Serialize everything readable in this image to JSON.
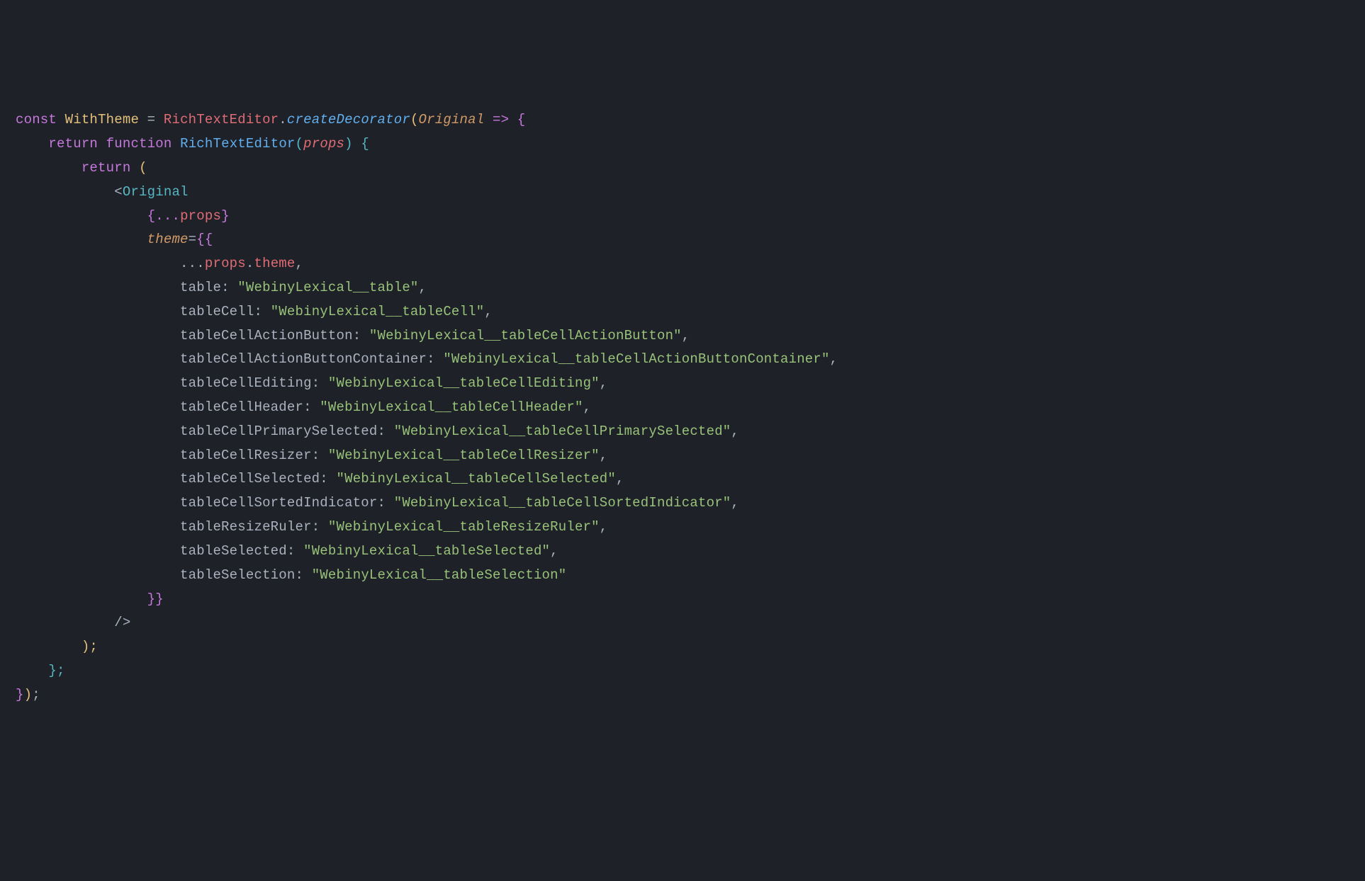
{
  "tokens": {
    "kw_const": "const",
    "var_withtheme": "WithTheme",
    "eq": " = ",
    "ident_rte": "RichTextEditor",
    "dot": ".",
    "fn_createdecorator": "createDecorator",
    "paren_o": "(",
    "paren_c": ")",
    "param_original": "Original",
    "arrow": " => ",
    "brace_o": "{",
    "brace_c": "}",
    "kw_return": "return",
    "kw_function": "function",
    "fn_rte": "RichTextEditor",
    "param_props": "props",
    "tag_open": "<",
    "comp_original": "Original",
    "spread_open": "{...",
    "prop_props": "props",
    "attr_theme": "theme",
    "eq_attr": "=",
    "dbl_brace_o": "{{",
    "dbl_brace_c": "}}",
    "spread": "...",
    "prop_theme": "theme",
    "comma": ",",
    "colon": ": ",
    "tag_selfclose": "/>",
    "semi": ";",
    "end_paren_semi": ");",
    "end_brace_semi": "};",
    "end_brace_paren_semi": "});"
  },
  "theme_props": [
    {
      "key": "table",
      "val": "\"WebinyLexical__table\""
    },
    {
      "key": "tableCell",
      "val": "\"WebinyLexical__tableCell\""
    },
    {
      "key": "tableCellActionButton",
      "val": "\"WebinyLexical__tableCellActionButton\""
    },
    {
      "key": "tableCellActionButtonContainer",
      "val": "\"WebinyLexical__tableCellActionButtonContainer\""
    },
    {
      "key": "tableCellEditing",
      "val": "\"WebinyLexical__tableCellEditing\""
    },
    {
      "key": "tableCellHeader",
      "val": "\"WebinyLexical__tableCellHeader\""
    },
    {
      "key": "tableCellPrimarySelected",
      "val": "\"WebinyLexical__tableCellPrimarySelected\""
    },
    {
      "key": "tableCellResizer",
      "val": "\"WebinyLexical__tableCellResizer\""
    },
    {
      "key": "tableCellSelected",
      "val": "\"WebinyLexical__tableCellSelected\""
    },
    {
      "key": "tableCellSortedIndicator",
      "val": "\"WebinyLexical__tableCellSortedIndicator\""
    },
    {
      "key": "tableResizeRuler",
      "val": "\"WebinyLexical__tableResizeRuler\""
    },
    {
      "key": "tableSelected",
      "val": "\"WebinyLexical__tableSelected\""
    },
    {
      "key": "tableSelection",
      "val": "\"WebinyLexical__tableSelection\""
    }
  ],
  "indent": {
    "g1": "    ",
    "g2": "        ",
    "g3": "            ",
    "g4": "                ",
    "g5": "                    ",
    "g6": "                        "
  }
}
